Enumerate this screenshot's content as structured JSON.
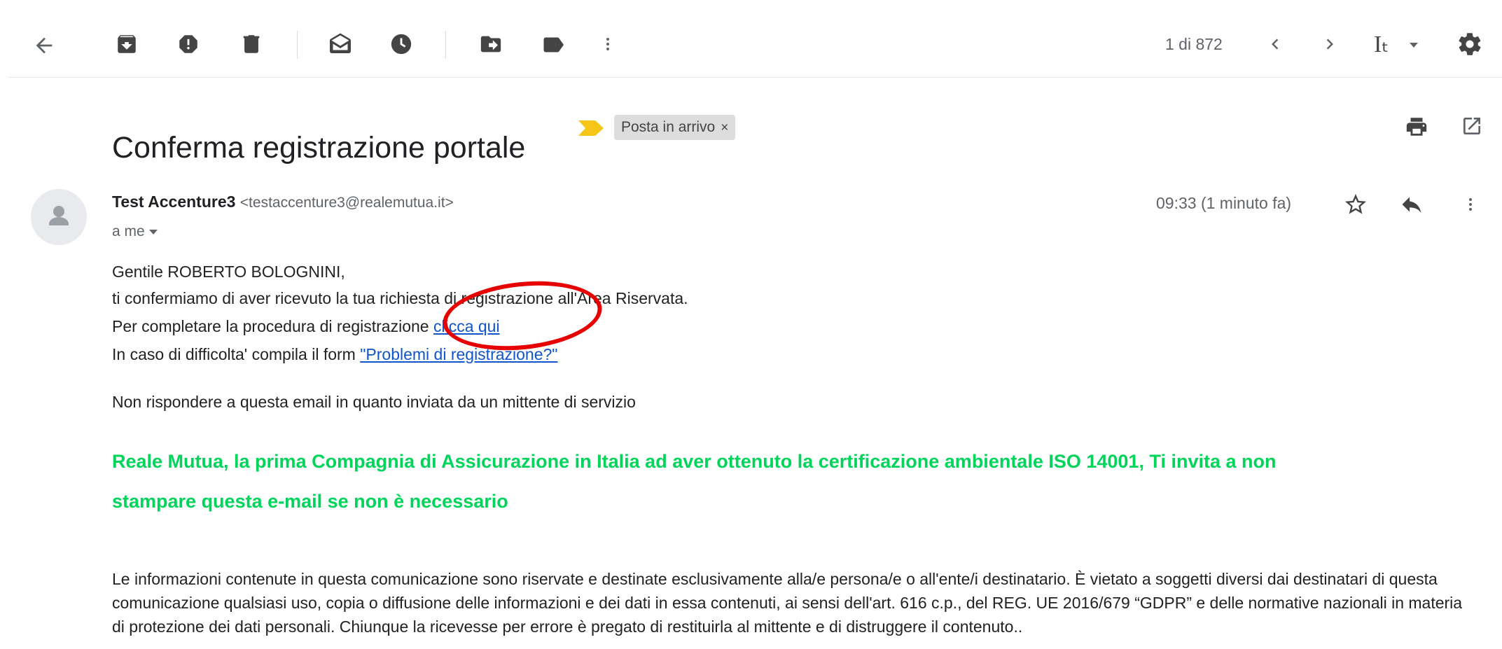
{
  "toolbar": {
    "back_icon": "arrow-left-icon",
    "archive_icon": "archive-icon",
    "spam_icon": "report-spam-icon",
    "delete_icon": "trash-icon",
    "mark_unread_icon": "mark-unread-icon",
    "snooze_icon": "clock-icon",
    "move_icon": "move-to-icon",
    "label_icon": "label-icon",
    "more_icon": "more-vert-icon",
    "counter": "1 di 872",
    "input_tools_label": "Iₜ"
  },
  "email": {
    "subject": "Conferma registrazione portale",
    "label": "Posta in arrivo",
    "label_close": "×",
    "sender_name": "Test Accenture3",
    "sender_email": "<testaccenture3@realemutua.it>",
    "to": "a me",
    "time": "09:33 (1 minuto fa)",
    "body": {
      "greeting": "Gentile ROBERTO BOLOGNINI,",
      "line1": "ti confermiamo di aver ricevuto la tua richiesta di registrazione all'Area Riservata.",
      "line2_prefix": "Per completare la procedura di registrazione ",
      "line2_link": "clicca qui",
      "line3_prefix": "In caso di difficolta' compila il form ",
      "line3_link": "\"Problemi di registrazione?\"",
      "no_reply": "Non rispondere a questa email in quanto inviata da un mittente di servizio",
      "green_line1": "Reale Mutua, la prima Compagnia di Assicurazione in Italia ad aver ottenuto la certificazione ambientale ISO 14001, Ti invita a non",
      "green_line2": "stampare questa e-mail se non è necessario",
      "disclaimer": "Le informazioni contenute in questa comunicazione sono riservate e destinate esclusivamente alla/e persona/e o all'ente/i destinatario. È vietato a soggetti diversi dai destinatari di questa comunicazione qualsiasi uso, copia o diffusione delle informazioni e dei dati in essa contenuti, ai sensi dell'art. 616 c.p., del REG. UE 2016/679 “GDPR” e delle normative nazionali in materia di protezione dei dati personali. Chiunque la ricevesse per errore è pregato di restituirla al mittente e di distruggere il contenuto.."
    }
  },
  "colors": {
    "green_notice": "#00d45a",
    "link": "#1155cc",
    "annotation_circle": "#e60000",
    "label_arrow": "#f5c518"
  }
}
